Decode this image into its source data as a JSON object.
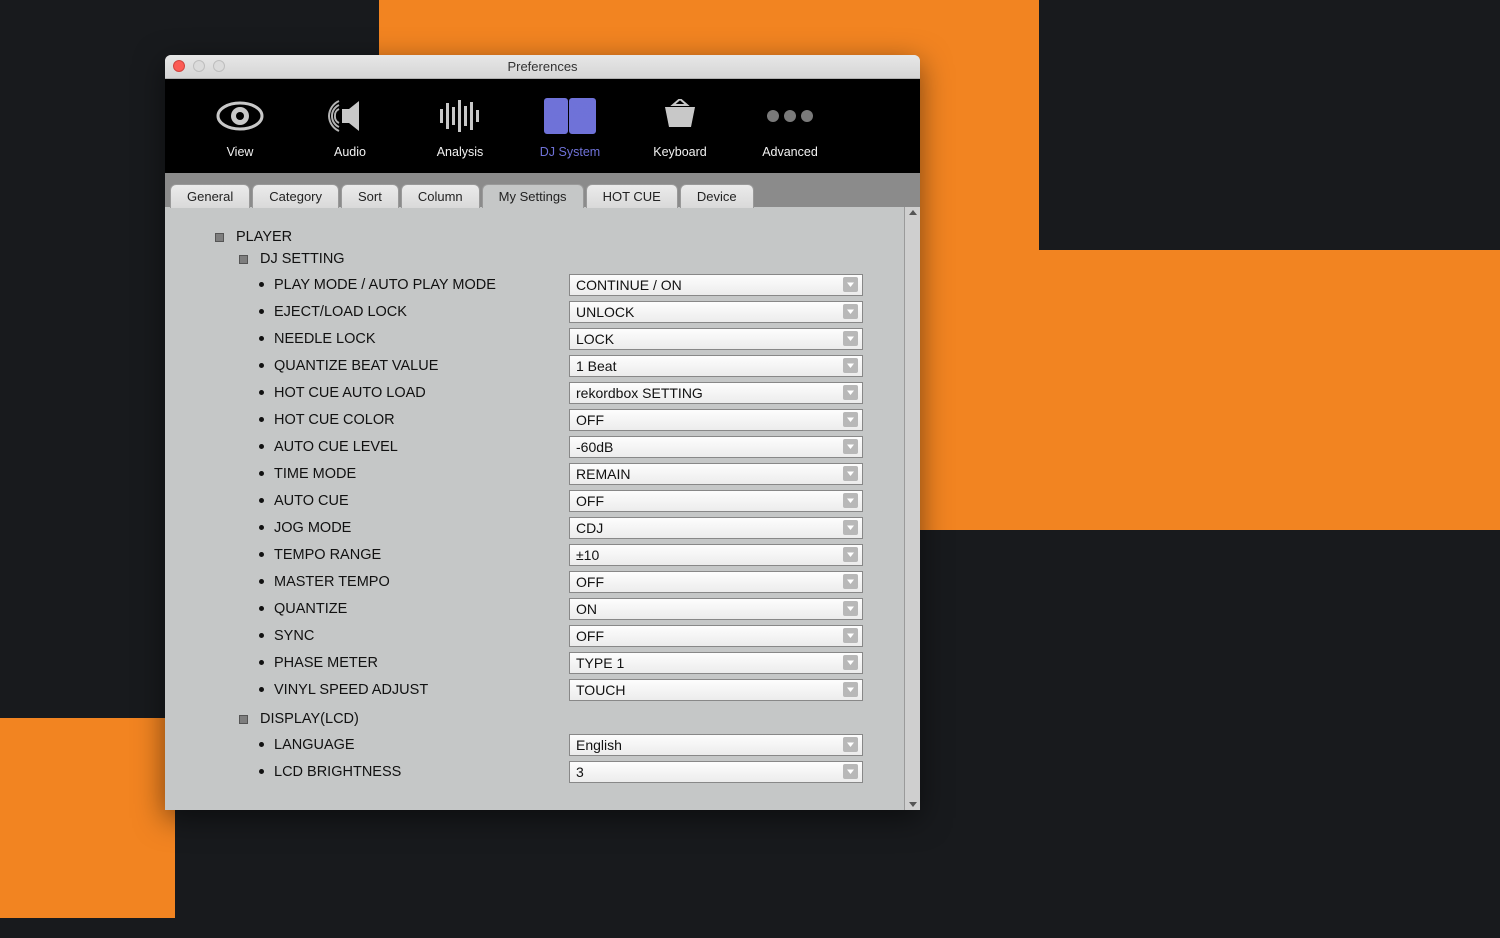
{
  "window": {
    "title": "Preferences"
  },
  "toolbar": {
    "items": [
      {
        "label": "View"
      },
      {
        "label": "Audio"
      },
      {
        "label": "Analysis"
      },
      {
        "label": "DJ System"
      },
      {
        "label": "Keyboard"
      },
      {
        "label": "Advanced"
      }
    ],
    "active_index": 3
  },
  "tabs": {
    "items": [
      {
        "label": "General"
      },
      {
        "label": "Category"
      },
      {
        "label": "Sort"
      },
      {
        "label": "Column"
      },
      {
        "label": "My Settings"
      },
      {
        "label": "HOT CUE"
      },
      {
        "label": "Device"
      }
    ],
    "active_index": 4
  },
  "sections": {
    "player_label": "PLAYER",
    "dj_setting_label": "DJ SETTING",
    "display_label": "DISPLAY(LCD)"
  },
  "settings": {
    "dj": [
      {
        "label": "PLAY MODE / AUTO PLAY MODE",
        "value": "CONTINUE / ON"
      },
      {
        "label": "EJECT/LOAD LOCK",
        "value": "UNLOCK"
      },
      {
        "label": "NEEDLE LOCK",
        "value": "LOCK"
      },
      {
        "label": "QUANTIZE BEAT VALUE",
        "value": "1 Beat"
      },
      {
        "label": "HOT CUE AUTO LOAD",
        "value": "rekordbox SETTING"
      },
      {
        "label": "HOT CUE COLOR",
        "value": "OFF"
      },
      {
        "label": "AUTO CUE LEVEL",
        "value": "-60dB"
      },
      {
        "label": "TIME MODE",
        "value": "REMAIN"
      },
      {
        "label": "AUTO CUE",
        "value": "OFF"
      },
      {
        "label": "JOG MODE",
        "value": "CDJ"
      },
      {
        "label": "TEMPO RANGE",
        "value": "±10"
      },
      {
        "label": "MASTER TEMPO",
        "value": "OFF"
      },
      {
        "label": "QUANTIZE",
        "value": "ON"
      },
      {
        "label": "SYNC",
        "value": "OFF"
      },
      {
        "label": "PHASE METER",
        "value": "TYPE 1"
      },
      {
        "label": "VINYL SPEED ADJUST",
        "value": "TOUCH"
      }
    ],
    "display": [
      {
        "label": "LANGUAGE",
        "value": "English"
      },
      {
        "label": "LCD BRIGHTNESS",
        "value": "3"
      }
    ]
  }
}
